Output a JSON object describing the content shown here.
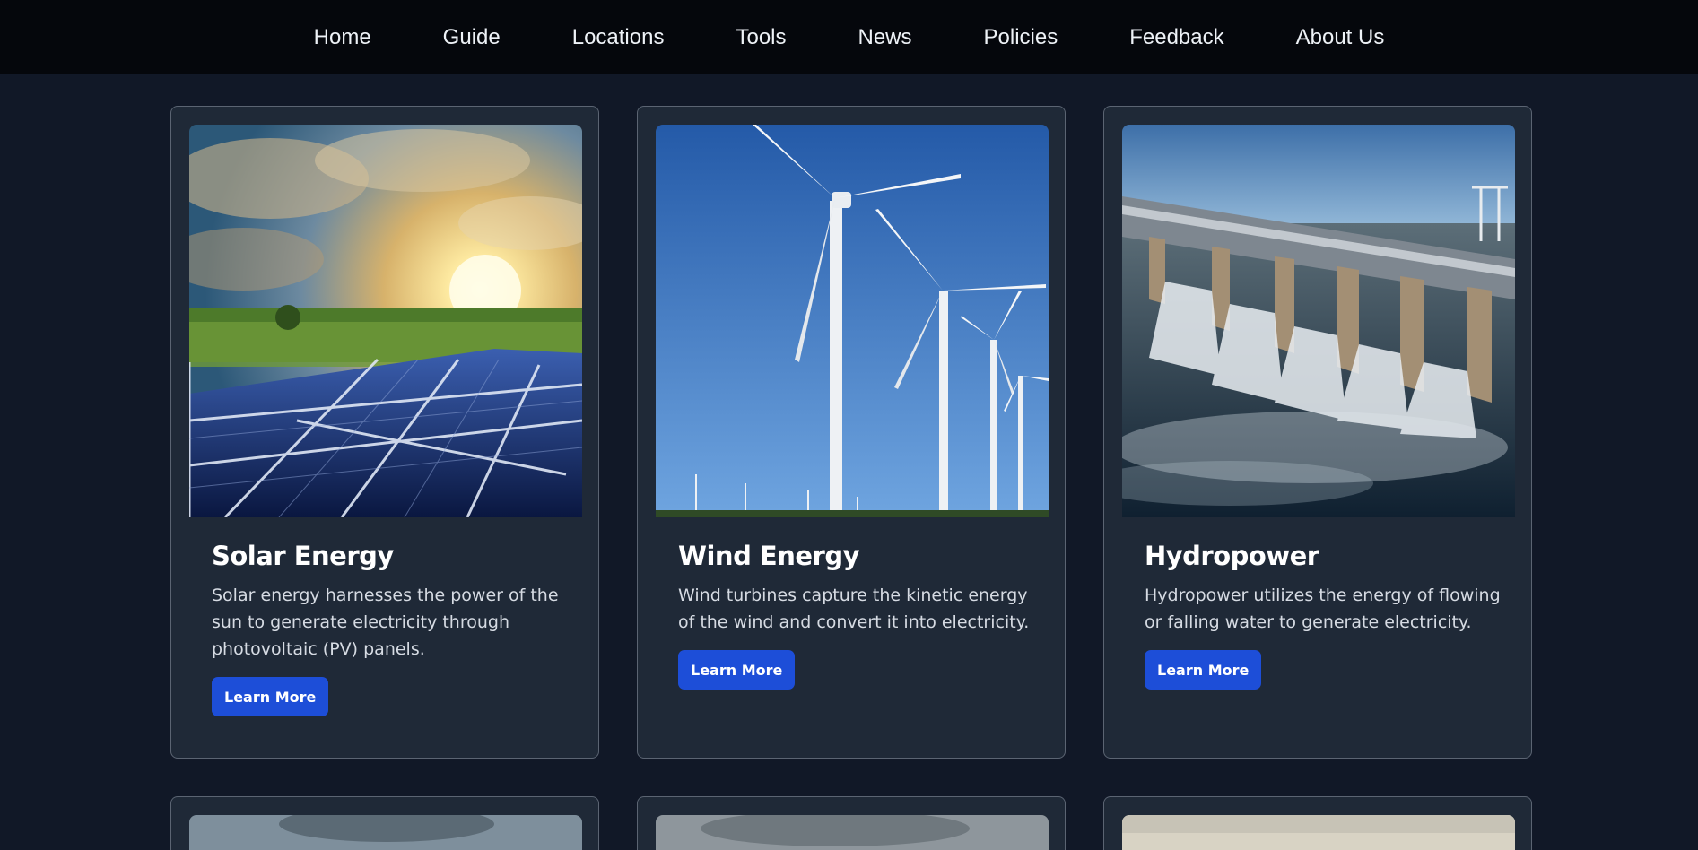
{
  "nav": {
    "items": [
      "Home",
      "Guide",
      "Locations",
      "Tools",
      "News",
      "Policies",
      "Feedback",
      "About Us"
    ]
  },
  "cards": [
    {
      "title": "Solar Energy",
      "description": "Solar energy harnesses the power of the sun to generate electricity through photovoltaic (PV) panels.",
      "button": "Learn More"
    },
    {
      "title": "Wind Energy",
      "description": "Wind turbines capture the kinetic energy of the wind and convert it into electricity.",
      "button": "Learn More"
    },
    {
      "title": "Hydropower",
      "description": "Hydropower utilizes the energy of flowing or falling water to generate electricity.",
      "button": "Learn More"
    }
  ],
  "colors": {
    "background": "#111827",
    "nav_background": "#05070c",
    "card_background": "#1f2937",
    "button": "#1d4ed8"
  }
}
